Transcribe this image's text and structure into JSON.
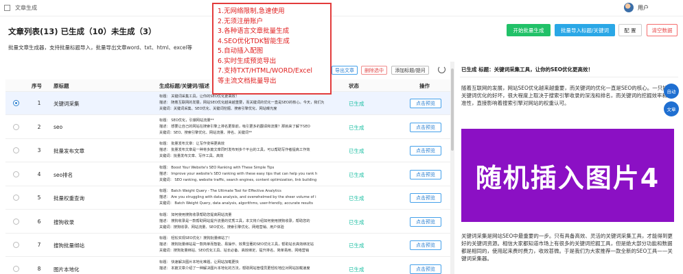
{
  "app": {
    "title": "文章生成",
    "user_label": "用户"
  },
  "page": {
    "title": "文章列表(13) 已生成（10）未生成（3）",
    "description": "批量文章生成器，支持批量标题导入，批量导出文章word、txt、html、excel等"
  },
  "toolbar": {
    "start_batch": "开始批量生成",
    "import_titles": "批量导入标题/关键词",
    "config": "配 置",
    "clear": "清空数据"
  },
  "list_actions": {
    "export": "导出文章",
    "delete_selected": "删除选中",
    "add_title": "添加标题/提问"
  },
  "table": {
    "headers": {
      "index": "序号",
      "source_title": "原标题",
      "generated": "生成标题/关键词/描述",
      "status": "状态",
      "action": "操作"
    },
    "rows": [
      {
        "index": "1",
        "name": "关键词采集",
        "line1": "标题：  关键词采集工具，让你的SEO优化更高效！",
        "line2": "描述：  随着互联网的发展，网站SEO优化越来越重要，而关键词的优化一直是SEO的核心。今天，我们为大家介绍一款高效，",
        "line3": "关键词：关键词采集、SEO优化、关键词挖掘、搜索引擎优化、网站曝光度",
        "status": "已生成",
        "action": "点击预览"
      },
      {
        "index": "2",
        "name": "seo",
        "line1": "标题：  SEO优化，引爆网站流量**",
        "line2": "描述：  想要让自己的网站在搜索引擎上排名更靠前，吸引更多的翻译和流量？那就来了解下SEO",
        "line3": "关键词：SEO、搜索引擎优化、网站流量、排名、关键词**",
        "status": "已生成",
        "action": "点击预览"
      },
      {
        "index": "3",
        "name": "批量发布文章",
        "line1": "标题：  批量发布文章：让写作变得更高效",
        "line2": "描述：  批量发布文章是一种将多篇文章同时发布到多个平台的工具，可以帮助写作者提高工作效",
        "line3": "关键词：批量发布文章、写作工具、高效",
        "status": "已生成",
        "action": "点击预览"
      },
      {
        "index": "4",
        "name": "seo排名",
        "line1": "标题：  Boost Your Website's SEO Ranking with These Simple Tips",
        "line2": "描述：  Improve your website's SEO ranking with these easy tips that can help you rank h",
        "line3": "关键词：  SEO ranking, website traffic, search engines, content optimization, link building",
        "status": "已生成",
        "action": "点击预览"
      },
      {
        "index": "5",
        "name": "批量权重查询",
        "line1": "标题：  Batch Weight Query - The Ultimate Tool for Effective Analytics",
        "line2": "描述：  Are you struggling with data analysis, and overwhelmed by the sheer volume of i",
        "line3": "关键词：  Batch Weight Query, data analysis, algorithms, user-friendly, accurate results",
        "status": "已生成",
        "action": "点击预览"
      },
      {
        "index": "6",
        "name": "搜狗收录",
        "line1": "标题：  如何使用搜狗收录帮助您提高网站流量",
        "line2": "描述：  搜狗收录是一款帮助网站提升流量的优秀工具，本文将介绍如何使用搜狗收录，帮助您的",
        "line3": "关键词：搜狗收录、网站流量、SEO优化、搜索引擎优化、网络营销、用户体验",
        "status": "已生成",
        "action": "点击预览"
      },
      {
        "index": "7",
        "name": "搜狗批量绑站",
        "line1": "标题：  轻松实现SEO优化！搜狗批量绑站了！",
        "line2": "描述：  搜狗批量绑站是一款简单而智能、易操作、效果显著的SEO优化工具，帮助站长高效绑定站",
        "line3": "关键词：搜狗批量绑站、SEO优化工具、站长必备、高效绑定、提升排名、简单易用、网络营销",
        "status": "已生成",
        "action": "点击预览"
      },
      {
        "index": "8",
        "name": "图片本地化",
        "line1": "标题：  快速解决图片本地化难题，让网站加载更快",
        "line2": "描述：  本篇文章介绍了一种解决图片本地化的方法，帮助网站管理员更轻松地应对网站加载速度",
        "line3": "",
        "status": "已生成",
        "action": "点击预览"
      }
    ]
  },
  "preview": {
    "title": "已生成 标题：关键词采集工具，让你的SEO优化更高效！",
    "para1": "随着互联网的发展，网站SEO优化越来越重要，而关键词的优化一直是SEO的核心。一只好的关键词优化的好坏，很大程度上取决于搜索引擎收录的深浅和排名，而关键词的挖掘效率和精准性，直接影响着搜索引擎对网站的权重认可。",
    "banner_text": "随机插入图片4",
    "para2": "关键词采集是网站SEO中最重要的一步。只有具备高效、灵活的关键词采集工具，才能得到更好的关键词资源。相信大家都知道市场上有很多的关键词挖掘工具，但是绝大部分功能和数据都是相同的，使用起来费时费力，收效甚微。于是我们为大家推荐一款全新的SEO工具——关键词采集器。",
    "float_auto": "自动",
    "float_text": "文章"
  },
  "overlay": {
    "lines": [
      "1.无网络限制,急速使用",
      "2.无须注册账户",
      "3.各种语言文章批量生成",
      "4.SEO优化TDK智能生成",
      "5.自动插入配图",
      "6.实时生成预览导出",
      "7.支持TXT/HTML/WORD/Excel",
      "等主流文档批量导出"
    ]
  },
  "colors": {
    "accent_green": "#21c168",
    "accent_blue": "#2aa7e6",
    "danger": "#e84c4c",
    "banner": "#8b10c4",
    "status": "#1cbfa3"
  }
}
